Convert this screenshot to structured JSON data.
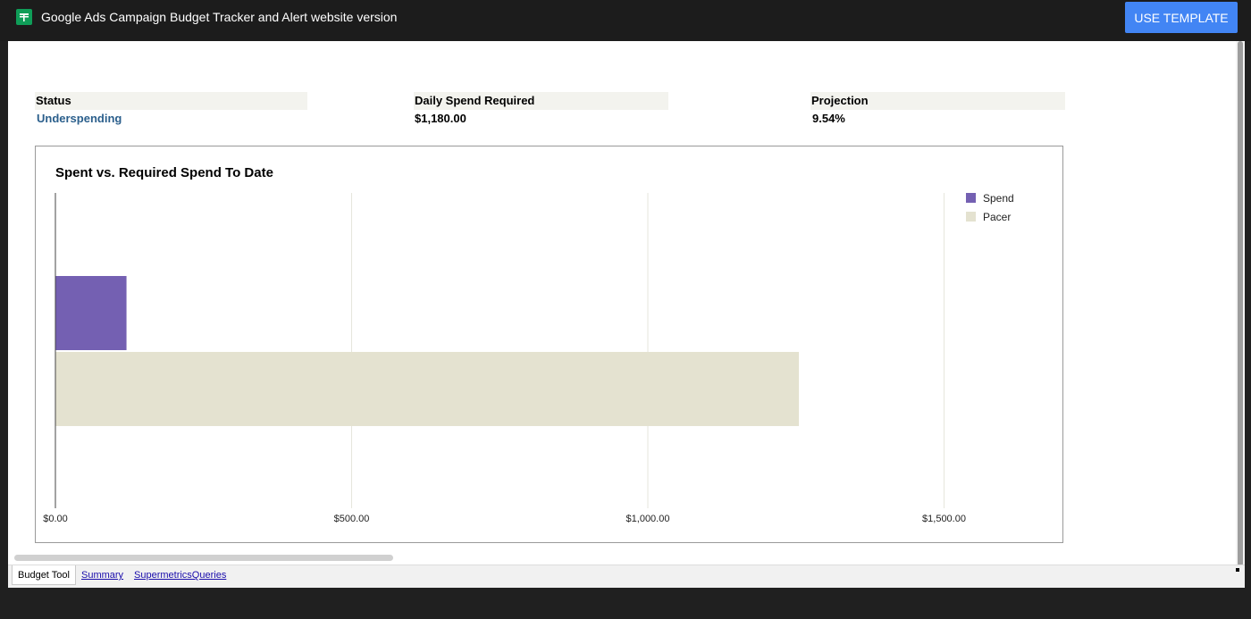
{
  "app": {
    "title": "Google Ads Campaign Budget Tracker and Alert website version",
    "use_template_label": "USE TEMPLATE",
    "icon": "google-sheets-icon"
  },
  "metrics": {
    "status": {
      "header": "Status",
      "value": "Underspending"
    },
    "daily": {
      "header": "Daily Spend Required",
      "value": "$1,180.00"
    },
    "projection": {
      "header": "Projection",
      "value": "9.54%"
    }
  },
  "colors": {
    "spend": "#7460b2",
    "pacer": "#e4e2d0",
    "status_link": "#2b5f8c",
    "accent": "#4285f4"
  },
  "chart_data": {
    "type": "bar",
    "orientation": "horizontal",
    "title": "Spent vs. Required Spend To Date",
    "xlabel": "",
    "ylabel": "",
    "xlim": [
      0,
      1700
    ],
    "x_ticks": [
      0,
      500,
      1000,
      1500
    ],
    "x_tick_labels": [
      "$0.00",
      "$500.00",
      "$1,000.00",
      "$1,500.00"
    ],
    "grid": true,
    "legend_position": "top-right",
    "series": [
      {
        "name": "Spend",
        "value": 120,
        "color": "#7460b2"
      },
      {
        "name": "Pacer",
        "value": 1255,
        "color": "#e4e2d0"
      }
    ]
  },
  "tabs": [
    {
      "label": "Budget Tool",
      "active": true
    },
    {
      "label": "Summary",
      "active": false
    },
    {
      "label": "SupermetricsQueries",
      "active": false
    }
  ]
}
